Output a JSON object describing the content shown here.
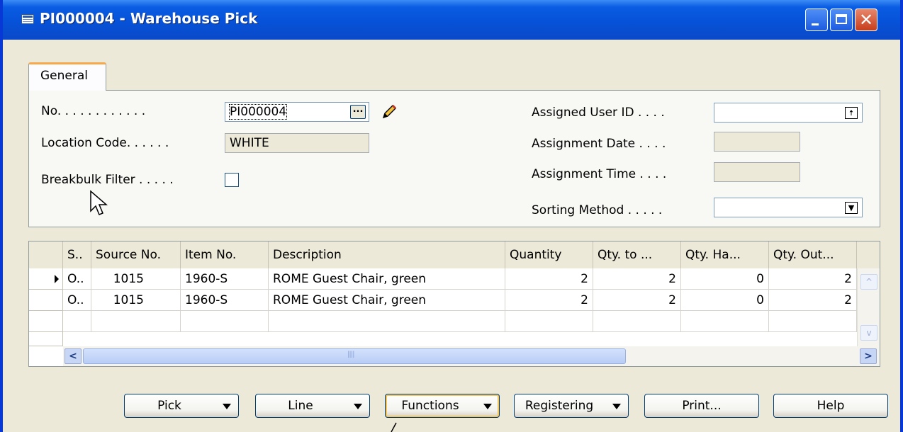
{
  "window": {
    "title": "PI000004 - Warehouse Pick",
    "app_icon": "form-icon",
    "controls": {
      "close_glyph": "✕"
    }
  },
  "tabs": [
    {
      "label": "General",
      "active": true
    }
  ],
  "header": {
    "no_label": "No. . . . . . . . . . . .",
    "no_value": "PI000004",
    "location_label": "Location Code. . . . . .",
    "location_value": "WHITE",
    "breakbulk_label": "Breakbulk Filter . . . . .",
    "breakbulk_checked": false,
    "assigned_user_label": "Assigned User ID . . . .",
    "assigned_user_value": "",
    "assignment_date_label": "Assignment Date . . . .",
    "assignment_date_value": "",
    "assignment_time_label": "Assignment Time . . . .",
    "assignment_time_value": "",
    "sorting_method_label": "Sorting Method . . . . .",
    "sorting_method_value": "",
    "ellipsis_glyph": "...",
    "lookup_glyph": "🠅",
    "dropdown_glyph": "▼"
  },
  "lines": {
    "columns": [
      "S..",
      "Source No.",
      "Item No.",
      "Description",
      "Quantity",
      "Qty. to ...",
      "Qty. Ha...",
      "Qty. Out..."
    ],
    "rows": [
      {
        "s": "O..",
        "source_no": "1015",
        "item_no": "1960-S",
        "description": "ROME Guest Chair, green",
        "quantity": "2",
        "qty_to": "2",
        "qty_handled": "0",
        "qty_out": "2",
        "current": true
      },
      {
        "s": "O..",
        "source_no": "1015",
        "item_no": "1960-S",
        "description": "ROME Guest Chair, green",
        "quantity": "2",
        "qty_to": "2",
        "qty_handled": "0",
        "qty_out": "2",
        "current": false
      }
    ],
    "scroll_left_glyph": "<",
    "scroll_right_glyph": ">",
    "scroll_up_glyph": "^",
    "scroll_down_glyph": "v"
  },
  "buttons": {
    "pick": "Pick",
    "line": "Line",
    "functions": "Functions",
    "registering": "Registering",
    "print": "Print...",
    "help": "Help"
  }
}
